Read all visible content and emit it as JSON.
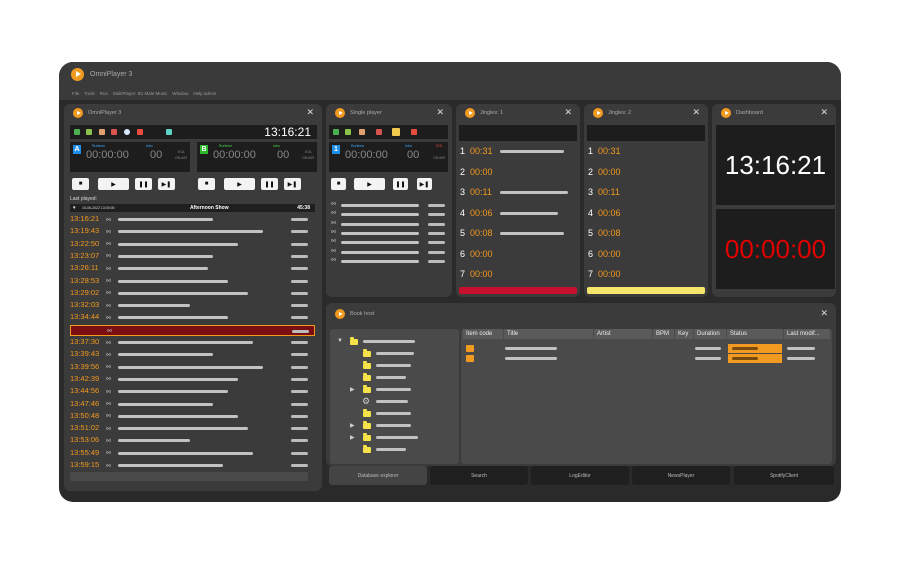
{
  "app": {
    "title": "OmniPlayer 3",
    "menu": [
      "File",
      "Tools",
      "Run",
      "MultiPlayer: B1 Male Music",
      "Window",
      "Help admin"
    ]
  },
  "omniplayer": {
    "title": "OmniPlayer 3",
    "clock": "13:16:21",
    "decks": [
      {
        "letter": "A",
        "runtime_label": "Runtime",
        "intro_label": "Intro",
        "time": "00:00:00",
        "intro": "00",
        "eol_label": "EOL",
        "onair_label": "ON AIR",
        "color": "#1f8ee8"
      },
      {
        "letter": "B",
        "runtime_label": "Runtime",
        "intro_label": "Intro",
        "time": "00:00:00",
        "intro": "00",
        "eol_label": "EOL",
        "onair_label": "ON AIR",
        "color": "#2eb82e"
      }
    ],
    "last_played_label": "Last played:",
    "show": {
      "date": "15-06-2022 13:00:00",
      "name": "Afternoon Show",
      "duration": "45:38"
    },
    "rows": [
      "13:16:21",
      "13:19:43",
      "13:22:50",
      "13:23:07",
      "13:26:11",
      "13:28:53",
      "13:29:02",
      "13:32:03",
      "13:34:44",
      "",
      "13:37:30",
      "13:39:43",
      "13:39:56",
      "13:42:39",
      "13:44:56",
      "13:47:46",
      "13:50:48",
      "13:51:02",
      "13:53:06",
      "13:55:49",
      "13:59:15"
    ]
  },
  "single_player": {
    "title": "Single player",
    "deck": {
      "letter": "1",
      "runtime_label": "Runtime",
      "intro_label": "Intro",
      "time": "00:00:00",
      "intro": "00",
      "eol_label": "EOL",
      "onair_label": "ON AIR"
    }
  },
  "jingles1": {
    "title": "Jingles: 1",
    "rows": [
      {
        "n": "1",
        "t": "00:31"
      },
      {
        "n": "2",
        "t": "00:00"
      },
      {
        "n": "3",
        "t": "00:11"
      },
      {
        "n": "4",
        "t": "00:06"
      },
      {
        "n": "5",
        "t": "00:08"
      },
      {
        "n": "6",
        "t": "00:00"
      },
      {
        "n": "7",
        "t": "00:00"
      }
    ],
    "color": "#c8102e"
  },
  "jingles2": {
    "title": "Jingles: 2",
    "rows": [
      {
        "n": "1",
        "t": "00:31"
      },
      {
        "n": "2",
        "t": "00:00"
      },
      {
        "n": "3",
        "t": "00:11"
      },
      {
        "n": "4",
        "t": "00:06"
      },
      {
        "n": "5",
        "t": "00:08"
      },
      {
        "n": "6",
        "t": "00:00"
      },
      {
        "n": "7",
        "t": "00:00"
      }
    ],
    "color": "#f5e66b"
  },
  "dashboard": {
    "title": "Dashboard",
    "clock": "13:16:21",
    "countdown": "00:00:00"
  },
  "book_host": {
    "title": "Book host",
    "columns": [
      "Item code",
      "Title",
      "Artist",
      "BPM",
      "Key",
      "Duration",
      "Status",
      "Last modif..."
    ]
  },
  "tabs": [
    "Database explorer",
    "Search",
    "LogEditor",
    "NewsPlayer",
    "SpotifyClient"
  ]
}
